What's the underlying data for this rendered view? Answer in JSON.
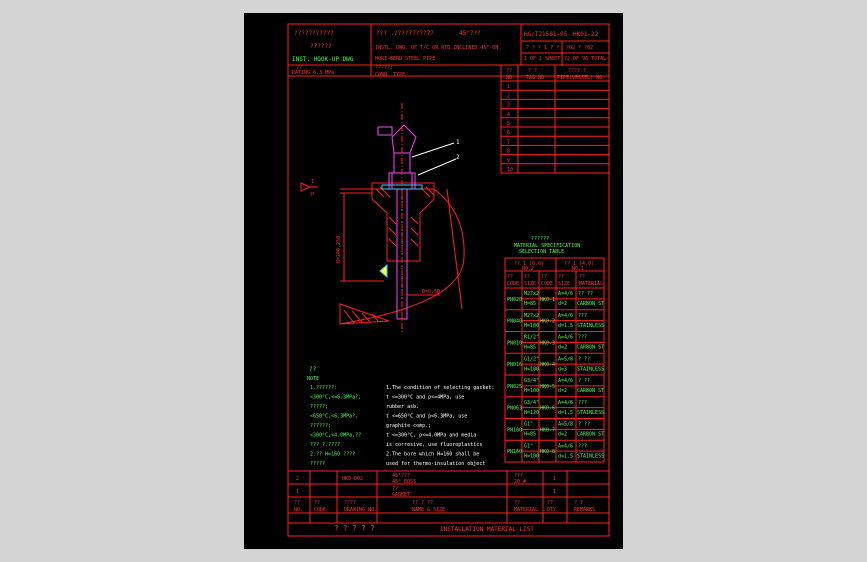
{
  "colors": {
    "background": "#d4d4d4",
    "sheet": "#000000",
    "frame": "#ff2020",
    "text_red": "#ff3030",
    "text_green": "#44ff44",
    "text_white": "#ffffff",
    "magenta": "#ff40ff",
    "cyan": "#30d0ff",
    "yellow": "#ffff40"
  },
  "header": {
    "qmarks_line1": "???????????",
    "qmarks_line2": "??????",
    "drawing_type": "INST. HOOK-UP DWG",
    "title_q": "??? .???????????",
    "angle_note": "45°???",
    "title_en1": "INSTL. DWG. OF T/C OR RTD INCLINED 45° ON",
    "title_en2": "HORI-BEND STEEL PIPE",
    "standard_no": "HG/T21581-95",
    "drawing_no": "HK01-22",
    "sheet_q": "? ? ? 1 ? ?",
    "sheet_text": "1 OF 1 SHEET",
    "total_q": "?02 ? ?02",
    "total_text": "?2 OF 96 TOTAL",
    "rating_q": "??",
    "rating": "RATING 6.3 MPa",
    "conn_q": "?????:",
    "conn": "CONN. TYPE",
    "col_no_q": "??",
    "col_no": "NO.",
    "col_tag_q": "? ?",
    "col_tag": "TAG NO",
    "col_pipe_q": "???? ?",
    "col_pipe": "PIPE(VESSEL) NO"
  },
  "row_numbers": [
    "1",
    "2",
    "3",
    "4",
    "5",
    "6",
    "7",
    "8",
    "9",
    "10"
  ],
  "drawing": {
    "callout_1": "1",
    "callout_2": "2",
    "flow_letter_1": "I",
    "flow_letter_2": "P",
    "dim_h": "H=200,250",
    "dim_d": "D=0.5D"
  },
  "material_table": {
    "title_q": "??????",
    "title_en1": "MATERIAL SPECIFICATION",
    "title_en2": "SELECTION TABLE",
    "head_q1": "?? 1 (0.0)",
    "head_q2": "?? 1 (4.0)",
    "head_en1": "NO.2",
    "head_en2": "NO.1",
    "col_code_q": "??",
    "col_code": "CODE",
    "col_size_q": "??",
    "col_size": "SIZE",
    "col_code2_q": "??",
    "col_code2": "CODE",
    "col_size2_q": "??",
    "col_size2": "SIZE",
    "col_mat_q": "??",
    "col_mat": "MATERIAL",
    "rows": [
      {
        "code": "PN020",
        "size1": "M27x2",
        "size2": "H=85",
        "code2": "HK0-1",
        "s1": "A=4/6",
        "s2": "d=2",
        "mat": "?? ??",
        "mat_en": "CARBON ST"
      },
      {
        "code": "PN040",
        "size1": "M27x2",
        "size2": "H=100",
        "code2": "HK0-2",
        "s1": "A=4/6",
        "s2": "d=1.5",
        "mat": "???",
        "mat_en": "STAINLESS"
      },
      {
        "code": "PN010",
        "size1": "R1/2\"",
        "size2": "H=85",
        "code2": "HK0-3",
        "s1": "A=4/6",
        "s2": "d=2",
        "mat": "???",
        "mat_en": "CARBON ST"
      },
      {
        "code": "PN016",
        "size1": "G1/2\"",
        "size2": "H=100",
        "code2": "HK0-4",
        "s1": "A=5/8",
        "s2": "d=3",
        "mat": "? ??",
        "mat_en": "STAINLESS"
      },
      {
        "code": "PN025",
        "size1": "G3/4\"",
        "size2": "H=100",
        "code2": "HK0-5",
        "s1": "A=4/6",
        "s2": "d=2",
        "mat": "? ??",
        "mat_en": "CARBON ST"
      },
      {
        "code": "PN063",
        "size1": "G3/4\"",
        "size2": "H=120",
        "code2": "HK0-6",
        "s1": "A=4/6",
        "s2": "d=1.5",
        "mat": "???",
        "mat_en": "STAINLESS"
      },
      {
        "code": "PN100",
        "size1": "G1\"",
        "size2": "H=85",
        "code2": "HK0-7",
        "s1": "A=5/8",
        "s2": "d=2",
        "mat": "? ??",
        "mat_en": "CARBON ST"
      },
      {
        "code": "PN160",
        "size1": "G1\"",
        "size2": "H=100",
        "code2": "HK0-8",
        "s1": "A=4/6",
        "s2": "d=1.5",
        "mat": "???",
        "mat_en": "STAINLESS"
      }
    ]
  },
  "notes": {
    "q_title": "??",
    "title": "NOTE",
    "left_lines": [
      "1.??????:",
      "  <300°C,<=6.3MPa?,",
      "  ?????;",
      "  <650°C,<6.3MPa?,",
      "  ??????;",
      "  <300°C,<4.0MPa,??",
      "  ??? ?.????",
      "2.?? H=160 ????",
      "  ?????"
    ],
    "right_lines": [
      "1.The condition of selecting gasket:",
      "  t <=300°C and p<=4MPa, use",
      "  rubber asb.",
      "  t <=650°C and p<6.3MPa, use",
      "  graphite comp.;",
      "  t <=300°C, p<=4.0MPa and media",
      "  is corrosive, use fluoroplastics",
      "2.The bore which H=160 shall be",
      "  used for thermo-insulation object"
    ]
  },
  "bom": {
    "rows": [
      {
        "no": "2",
        "code": "",
        "dwg": "HK0-D02",
        "name_q": "45°???",
        "name": "45° BOSS",
        "mat_q": "???",
        "mat": "20 #",
        "qty": "1",
        "rem": ""
      },
      {
        "no": "1",
        "code": "",
        "dwg": "",
        "name_q": "??",
        "name": "GASKET",
        "mat_q": "",
        "mat": "",
        "qty": "1",
        "rem": ""
      }
    ],
    "head": {
      "no_q": "??",
      "no": "NO.",
      "code_q": "??",
      "code": "CODE",
      "dwg_q": "????",
      "dwg": "DRAWING NO.",
      "name_q": "?? ? ??",
      "name": "NAME & SIZE",
      "mat_q": "??",
      "mat": "MATERIAL",
      "qty_q": "??",
      "qty": "QTY",
      "rem_q": "? ?",
      "rem": "REMARKS"
    },
    "footer_q": "? ? ? ? ?",
    "footer": "INSTALLATION MATERIAL LIST"
  }
}
